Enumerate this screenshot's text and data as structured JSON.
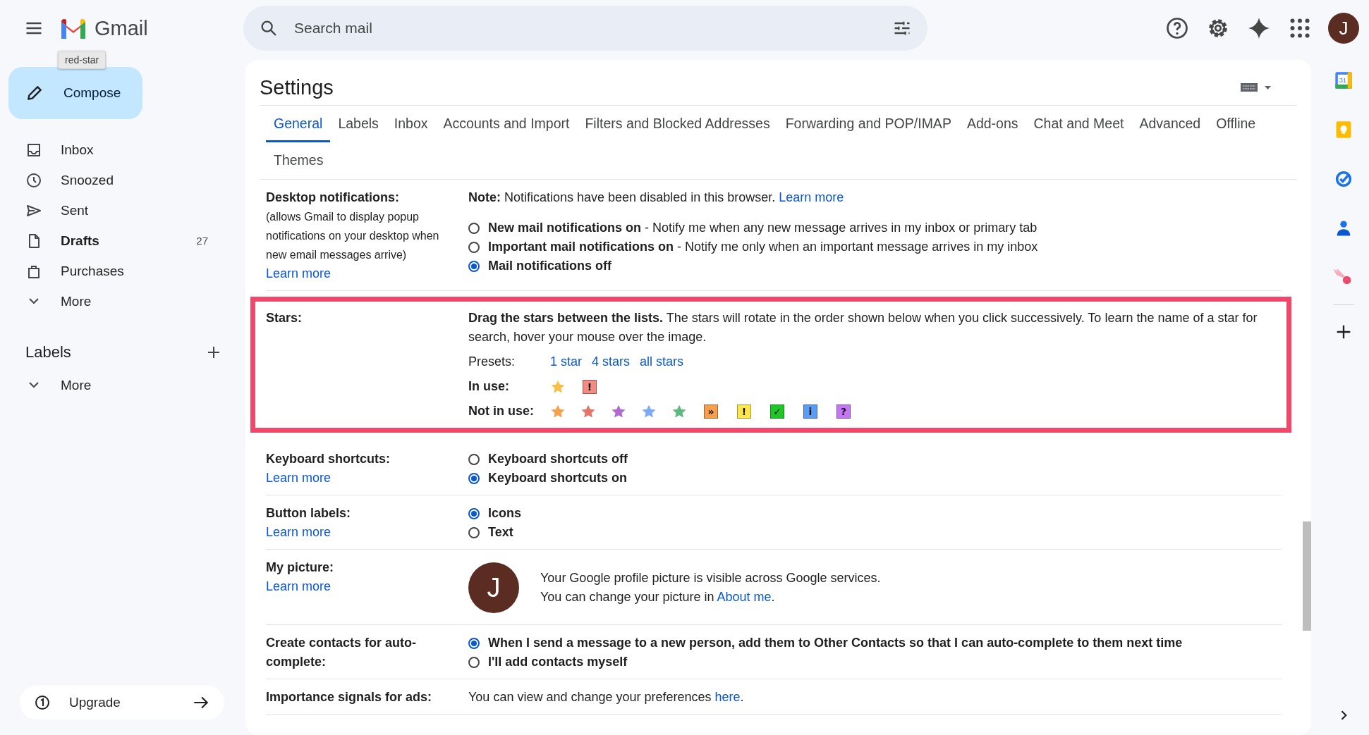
{
  "header": {
    "product": "Gmail",
    "search": {
      "placeholder": "Search mail"
    },
    "avatar": "J"
  },
  "tooltip": "red-star",
  "compose": "Compose",
  "nav": [
    {
      "label": "Inbox",
      "kind": "inbox",
      "unread": false
    },
    {
      "label": "Snoozed",
      "kind": "snoozed",
      "unread": false
    },
    {
      "label": "Sent",
      "kind": "sent",
      "unread": false
    },
    {
      "label": "Drafts",
      "kind": "drafts",
      "unread": true,
      "count": "27"
    },
    {
      "label": "Purchases",
      "kind": "purchases",
      "unread": false
    },
    {
      "label": "More",
      "kind": "more",
      "unread": false
    }
  ],
  "labels": {
    "title": "Labels",
    "more": "More"
  },
  "upgrade": "Upgrade",
  "rail": {
    "calendar_day": "31"
  },
  "settings": {
    "title": "Settings",
    "tabs": [
      {
        "label": "General",
        "selected": true
      },
      {
        "label": "Labels",
        "selected": false
      },
      {
        "label": "Inbox",
        "selected": false
      },
      {
        "label": "Accounts and Import",
        "selected": false
      },
      {
        "label": "Filters and Blocked Addresses",
        "selected": false
      },
      {
        "label": "Forwarding and POP/IMAP",
        "selected": false
      },
      {
        "label": "Add-ons",
        "selected": false
      },
      {
        "label": "Chat and Meet",
        "selected": false
      },
      {
        "label": "Advanced",
        "selected": false
      },
      {
        "label": "Offline",
        "selected": false
      },
      {
        "label": "Themes",
        "selected": false
      }
    ],
    "sections": [
      {
        "kind": "radios",
        "label": "Desktop notifications:",
        "sublabel": "(allows Gmail to display popup notifications on your desktop when new email messages arrive)",
        "link": "Learn more",
        "highlighted": false,
        "note": "**Note:** Notifications have been disabled in this browser.",
        "note_link": "Learn more",
        "options": [
          {
            "label": "New mail notifications on",
            "description": "- Notify me when any new message arrives in my inbox or primary tab",
            "selected": false
          },
          {
            "label": "Important mail notifications on",
            "description": "- Notify me only when an important message arrives in my inbox",
            "selected": false
          },
          {
            "label": "Mail notifications off",
            "selected": true
          }
        ]
      },
      {
        "kind": "stars",
        "label": "Stars:",
        "highlighted": true,
        "intro": "**Drag the stars between the lists.**  The stars will rotate in the order shown below when you click successively. To learn the name of a star for search, hover your mouse over the image.",
        "presets_label": "Presets:",
        "presets": [
          "1 star",
          "4 stars",
          "all stars"
        ],
        "in_use_label": "In use:",
        "in_use": [
          {
            "kind": "star",
            "color": "#f7c04a"
          },
          {
            "kind": "badge",
            "color": "#f28b82",
            "symbol": "!"
          }
        ],
        "not_in_use_label": "Not in use:",
        "not_in_use": [
          {
            "kind": "star",
            "color": "#f6a04d"
          },
          {
            "kind": "star",
            "color": "#e57368"
          },
          {
            "kind": "star",
            "color": "#b06bd1"
          },
          {
            "kind": "star",
            "color": "#7baaf7"
          },
          {
            "kind": "star",
            "color": "#5fb87d"
          },
          {
            "kind": "badge",
            "color": "#f6a04d",
            "symbol": "»"
          },
          {
            "kind": "badge",
            "color": "#fde74c",
            "symbol": "!"
          },
          {
            "kind": "badge",
            "color": "#1ec726",
            "symbol": "✓"
          },
          {
            "kind": "badge",
            "color": "#5a9df5",
            "symbol": "i"
          },
          {
            "kind": "badge",
            "color": "#c476f5",
            "symbol": "?"
          }
        ]
      },
      {
        "kind": "radios",
        "label": "Keyboard shortcuts:",
        "link": "Learn more",
        "highlighted": false,
        "options": [
          {
            "label": "Keyboard shortcuts off",
            "selected": false
          },
          {
            "label": "Keyboard shortcuts on",
            "selected": true
          }
        ]
      },
      {
        "kind": "radios",
        "label": "Button labels:",
        "link": "Learn more",
        "highlighted": false,
        "options": [
          {
            "label": "Icons",
            "selected": true
          },
          {
            "label": "Text",
            "selected": false
          }
        ]
      },
      {
        "kind": "picture",
        "label": "My picture:",
        "link": "Learn more",
        "highlighted": false,
        "avatar": "J",
        "line1": "Your Google profile picture is visible across Google services.",
        "line2": {
          "before": "You can change your picture in ",
          "link": "About me",
          "after": "."
        }
      },
      {
        "kind": "radios",
        "label": "Create contacts for auto-complete:",
        "highlighted": false,
        "options": [
          {
            "label": "When I send a message to a new person, add them to Other Contacts so that I can auto-complete to them next time",
            "selected": true
          },
          {
            "label": "I'll add contacts myself",
            "selected": false
          }
        ]
      },
      {
        "kind": "text",
        "label": "Importance signals for ads:",
        "highlighted": false,
        "text": {
          "before": "You can view and change your preferences ",
          "link": "here",
          "after": "."
        }
      }
    ]
  }
}
